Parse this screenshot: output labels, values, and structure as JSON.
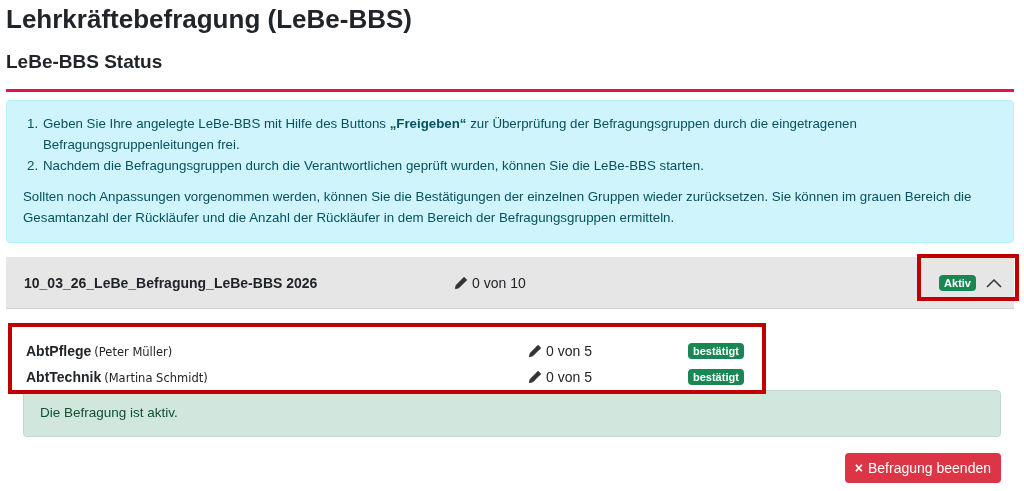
{
  "title": "Lehrkräftebefragung (LeBe-BBS)",
  "subtitle": "LeBe-BBS Status",
  "info": {
    "steps": [
      {
        "marker": "1.",
        "text": "Geben Sie Ihre angelegte LeBe-BBS mit Hilfe des Buttons **„Freigeben“** zur Überprüfung der Befragungsgruppen durch die eingetragenen Befragungsgruppenleitungen frei."
      },
      {
        "marker": "2.",
        "text": "Nachdem die Befragungsgruppen durch die Verantwortlichen geprüft wurden, können Sie die LeBe-BBS starten."
      }
    ],
    "note": "Sollten noch Anpassungen vorgenommen werden, können Sie die Bestätigungen der einzelnen Gruppen wieder zurücksetzen. Sie können im grauen Bereich die Gesamtanzahl der Rückläufer und die Anzahl der Rückläufer in dem Bereich der Befragungsgruppen ermitteln."
  },
  "survey": {
    "name": "10_03_26_LeBe_Befragung_LeBe-BBS 2026",
    "count": "0 von 10",
    "badge": "Aktiv",
    "expanded": true,
    "groups": [
      {
        "name": "AbtPflege",
        "person": "(Peter Müller)",
        "count": "0 von 5",
        "badge": "bestätigt"
      },
      {
        "name": "AbtTechnik",
        "person": "(Martina Schmidt)",
        "count": "0 von 5",
        "badge": "bestätigt"
      }
    ],
    "status": "Die Befragung ist aktiv."
  },
  "end_button": {
    "icon": "×",
    "label": "Befragung beenden"
  }
}
